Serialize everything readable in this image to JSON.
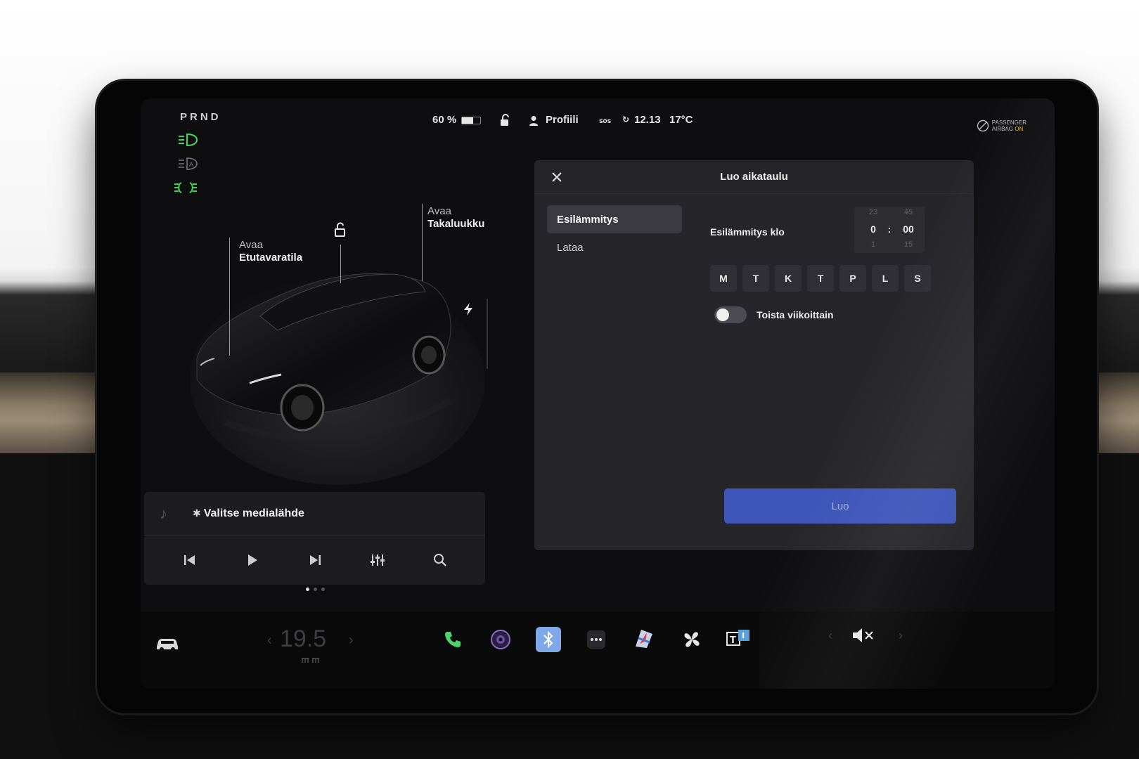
{
  "status_bar": {
    "gear": "PRND",
    "battery": "60 %",
    "battery_level": 0.6,
    "profile": "Profiili",
    "sos": "sos",
    "time": "12.13",
    "temperature": "17°C",
    "airbag_line1": "PASSENGER",
    "airbag_line2": "AIRBAG",
    "airbag_state": "ON"
  },
  "car": {
    "frunk_action": "Avaa",
    "frunk_label": "Etutavaratila",
    "trunk_action": "Avaa",
    "trunk_label": "Takaluukku"
  },
  "media": {
    "source_label": "Valitse medialähde",
    "controls": [
      "previous",
      "play",
      "next",
      "equalizer",
      "search"
    ]
  },
  "schedule_panel": {
    "title": "Luo aikataulu",
    "tabs": [
      {
        "label": "Esilämmitys",
        "active": true
      },
      {
        "label": "Lataa",
        "active": false
      }
    ],
    "time_label": "Esilämmitys klo",
    "hour_prev": "23",
    "hour": "0",
    "hour_next": "1",
    "separator": ":",
    "minute_prev": "45",
    "minute": "00",
    "minute_next": "15",
    "days": [
      "M",
      "T",
      "K",
      "T",
      "P",
      "L",
      "S"
    ],
    "repeat_label": "Toista viikoittain",
    "repeat_on": false,
    "create_label": "Luo"
  },
  "dock": {
    "cabin_temp": "19.5",
    "apps": [
      "car-icon",
      "phone-icon",
      "camera-icon",
      "bluetooth-icon",
      "more-icon",
      "navigation-icon",
      "fan-icon",
      "theater-icon"
    ],
    "volume_state": "muted"
  },
  "colors": {
    "accent_green": "#3fd65a",
    "button_blue": "#3d55b9",
    "panel_bg": "#25252a"
  }
}
